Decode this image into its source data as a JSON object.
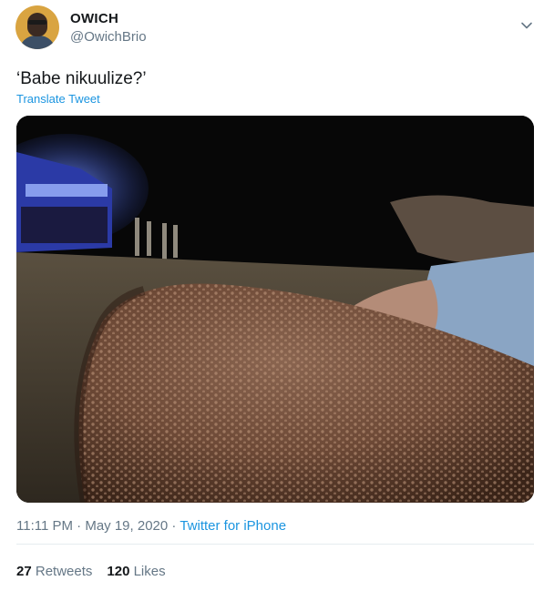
{
  "user": {
    "display_name": "OWICH",
    "handle": "@OwichBrio"
  },
  "tweet": {
    "text": "‘Babe nikuulize?’",
    "translate_label": "Translate Tweet",
    "time": "11:11 PM",
    "date": "May 19, 2020",
    "source": "Twitter for iPhone",
    "separator": "·"
  },
  "stats": {
    "retweets_count": "27",
    "retweets_label": "Retweets",
    "likes_count": "120",
    "likes_label": "Likes"
  },
  "icons": {
    "more_menu": "chevron-down-icon"
  },
  "colors": {
    "link": "#1b95e0",
    "secondary_text": "#657786",
    "primary_text": "#14171a",
    "divider": "#e6ecf0"
  }
}
